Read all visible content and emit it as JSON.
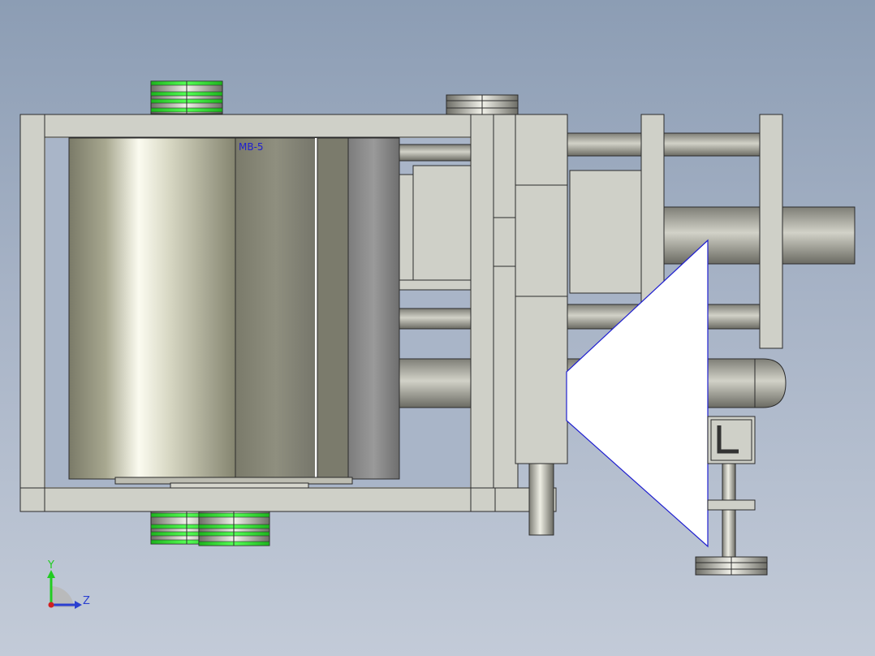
{
  "viewport": {
    "part_label": "MB-5",
    "triad": {
      "y_label": "Y",
      "z_label": "Z",
      "y_color": "#22cc22",
      "z_color": "#2a3fd0"
    }
  },
  "colors": {
    "background_top": "#8c9db4",
    "background_bottom": "#c3cbd8",
    "frame_fill": "#cfd0c8",
    "outline": "#2b2b2b",
    "pulley_green": "#2fe02f",
    "label_blue": "#2020d0",
    "highlight_white": "#ffffff"
  }
}
